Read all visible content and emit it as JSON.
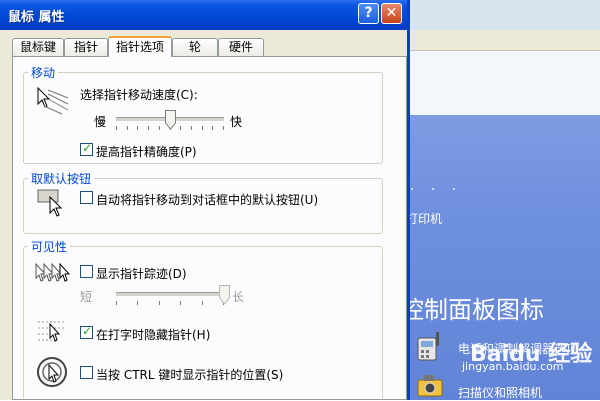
{
  "background": {
    "dots": ". . .",
    "printer_label": "打印机",
    "heading": "控制面板图标",
    "items": [
      {
        "label": "电话和调制解调器选项",
        "icon": "phone-modem-icon"
      },
      {
        "label": "扫描仪和照相机",
        "icon": "scanner-camera-icon"
      }
    ],
    "watermark": {
      "main": "Baidu 经验",
      "sub": "jingyan.baidu.com"
    }
  },
  "dialog": {
    "title": "鼠标 属性",
    "help_symbol": "?",
    "close_symbol": "✕",
    "tabs": [
      {
        "label": "鼠标键",
        "active": false
      },
      {
        "label": "指针",
        "active": false
      },
      {
        "label": "指针选项",
        "active": true
      },
      {
        "label": "轮",
        "active": false
      },
      {
        "label": "硬件",
        "active": false
      }
    ],
    "motion": {
      "legend": "移动",
      "speed_label": "选择指针移动速度(C):",
      "slow": "慢",
      "fast": "快",
      "speed_level": 0.5,
      "precision_label": "提高指针精确度(P)",
      "precision_checked": true
    },
    "snap": {
      "legend": "取默认按钮",
      "snap_label": "自动将指针移动到对话框中的默认按钮(U)",
      "snap_checked": false
    },
    "visibility": {
      "legend": "可见性",
      "trails_label": "显示指针踪迹(D)",
      "trails_checked": false,
      "short": "短",
      "long": "长",
      "trails_level": 1.0,
      "hide_label": "在打字时隐藏指针(H)",
      "hide_checked": true,
      "ctrl_label": "当按 CTRL 键时显示指针的位置(S)",
      "ctrl_checked": false
    }
  },
  "colors": {
    "titlebar": "#0a55e0",
    "dialog_face": "#ece9d8",
    "group_legend": "#0046d5",
    "active_tab_accent": "#f0a33a",
    "desktop_panel": "#6f8fdf"
  }
}
